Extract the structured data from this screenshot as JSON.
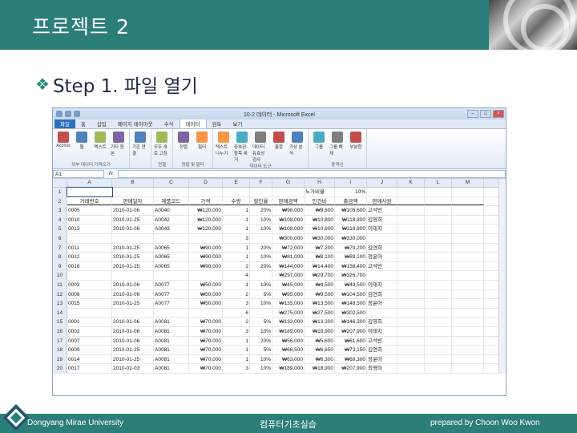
{
  "slide": {
    "title": "프로젝트 2",
    "subtitle": "Step 1. 파일 열기"
  },
  "excel": {
    "window_title": "10-2 데이터 - Microsoft Excel",
    "tabs": [
      "파일",
      "홈",
      "삽입",
      "페이지 레이아웃",
      "수식",
      "데이터",
      "검토",
      "보기"
    ],
    "active_tab": "데이터",
    "ribbon_groups": [
      {
        "name": "외부 데이터 가져오기",
        "buttons": [
          "Access",
          "웹",
          "텍스트",
          "기타 원본"
        ]
      },
      {
        "name": "",
        "buttons": [
          "기존 연결"
        ]
      },
      {
        "name": "연결",
        "buttons": [
          "모두 새로 고침"
        ]
      },
      {
        "name": "정렬 및 필터",
        "buttons": [
          "정렬",
          "필터"
        ]
      },
      {
        "name": "데이터 도구",
        "buttons": [
          "텍스트 나누기",
          "중복된 항목 제거",
          "데이터 유효성 검사",
          "통합",
          "가상 분석"
        ]
      },
      {
        "name": "윤곽선",
        "buttons": [
          "그룹",
          "그룹 해제",
          "부분합"
        ]
      }
    ],
    "name_box": "A1",
    "fx_label": "fx",
    "columns": [
      "A",
      "B",
      "C",
      "D",
      "E",
      "F",
      "G",
      "H",
      "I",
      "J",
      "K",
      "L",
      "M"
    ],
    "rows": [
      [
        "",
        "",
        "",
        "",
        "",
        "",
        "",
        "",
        "",
        "",
        "",
        "",
        ""
      ],
      [
        "거래번호",
        "판매일자",
        "제품코드",
        "가격",
        "수량",
        "할인율",
        "판매금액",
        "인건비",
        "총금액",
        "판매사원",
        "",
        "",
        ""
      ],
      [
        "0005",
        "2010-01-06",
        "A0040",
        "₩120,000",
        "1",
        "20%",
        "₩96,000",
        "₩9,600",
        "₩105,600",
        "고석빈",
        "",
        "",
        ""
      ],
      [
        "0010",
        "2010-01-25",
        "A0042",
        "₩120,000",
        "1",
        "10%",
        "₩108,000",
        "₩10,800",
        "₩118,800",
        "김영희",
        "",
        "",
        ""
      ],
      [
        "0013",
        "2010-01-06",
        "A0043",
        "₩120,000",
        "1",
        "10%",
        "₩108,000",
        "₩10,800",
        "₩118,800",
        "이태지",
        "",
        "",
        ""
      ],
      [
        "",
        "",
        "",
        "",
        "3",
        "",
        "₩300,000",
        "₩30,000",
        "₩330,000",
        "",
        "",
        "",
        ""
      ],
      [
        "0011",
        "2010-01-25",
        "A0065",
        "₩90,000",
        "1",
        "20%",
        "₩72,000",
        "₩7,200",
        "₩79,200",
        "김연희",
        "",
        "",
        ""
      ],
      [
        "0012",
        "2010-01-25",
        "A0065",
        "₩90,000",
        "1",
        "10%",
        "₩81,000",
        "₩8,100",
        "₩89,100",
        "정윤아",
        "",
        "",
        ""
      ],
      [
        "0018",
        "2010-01-25",
        "A0065",
        "₩90,000",
        "2",
        "20%",
        "₩144,000",
        "₩14,400",
        "₩158,400",
        "고석빈",
        "",
        "",
        ""
      ],
      [
        "",
        "",
        "",
        "",
        "4",
        "",
        "₩297,000",
        "₩29,700",
        "₩326,700",
        "",
        "",
        "",
        ""
      ],
      [
        "0003",
        "2010-01-06",
        "A0077",
        "₩50,000",
        "1",
        "10%",
        "₩45,000",
        "₩4,500",
        "₩49,500",
        "이태지",
        "",
        "",
        ""
      ],
      [
        "0008",
        "2010-01-06",
        "A0077",
        "₩50,000",
        "2",
        "5%",
        "₩95,000",
        "₩9,500",
        "₩104,500",
        "김연희",
        "",
        "",
        ""
      ],
      [
        "0015",
        "2010-01-25",
        "A0077",
        "₩50,000",
        "3",
        "10%",
        "₩135,000",
        "₩13,500",
        "₩148,500",
        "정윤아",
        "",
        "",
        ""
      ],
      [
        "",
        "",
        "",
        "",
        "6",
        "",
        "₩275,000",
        "₩27,500",
        "₩302,500",
        "",
        "",
        "",
        ""
      ],
      [
        "0001",
        "2010-01-06",
        "A0081",
        "₩70,000",
        "2",
        "5%",
        "₩133,000",
        "₩13,300",
        "₩146,300",
        "김영희",
        "",
        "",
        ""
      ],
      [
        "0002",
        "2010-01-06",
        "A0081",
        "₩70,000",
        "3",
        "10%",
        "₩189,000",
        "₩18,900",
        "₩207,900",
        "이태지",
        "",
        "",
        ""
      ],
      [
        "0007",
        "2010-01-06",
        "A0081",
        "₩70,000",
        "1",
        "20%",
        "₩56,000",
        "₩5,600",
        "₩61,600",
        "고석빈",
        "",
        "",
        ""
      ],
      [
        "0009",
        "2010-01-25",
        "A0081",
        "₩70,000",
        "1",
        "5%",
        "₩66,500",
        "₩6,650",
        "₩73,150",
        "김연희",
        "",
        "",
        ""
      ],
      [
        "0014",
        "2010-01-25",
        "A0081",
        "₩70,000",
        "1",
        "10%",
        "₩63,000",
        "₩6,300",
        "₩69,300",
        "정윤아",
        "",
        "",
        ""
      ],
      [
        "0017",
        "2010-02-03",
        "A0081",
        "₩70,000",
        "3",
        "10%",
        "₩189,000",
        "₩18,900",
        "₩207,900",
        "최영미",
        "",
        "",
        ""
      ]
    ],
    "extra_cells": {
      "h1": "노가비율",
      "i1": "10%"
    }
  },
  "footer": {
    "left": "Dongyang Mirae University",
    "center": "컴퓨터기초실습",
    "right": "prepared by Choon Woo Kwon"
  }
}
